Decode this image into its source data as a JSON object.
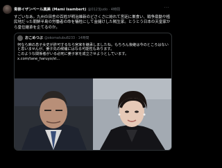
{
  "post": {
    "author_name": "青柳イザンベール真美 (Mami Isambert)",
    "author_handle": "@0123Judo · 4時間",
    "more_icon": "...",
    "body": "すごいなあ。九州の田舎の百姓が明治維新のどさくさに紛れて宮廷に巣食い、戦争扇動や植民地だった朝鮮半島の労働者の命を犠牲にして金儲けした賊生家。とうとう日本の天皇家から皇位継承を企てるのか。",
    "quote": {
      "author_name": "おこめつぶ",
      "author_handle": "@okomatubu8233 · 14時間",
      "text": "何なら麻の息子女史が許可するなら宮家を継承しましたね。もちろん後継は今のところはないと思いませんが、姜子先の候補にはなる可能性もあります。",
      "text2": "このような関係者がいる必死に姜子家を成立させようとしています。",
      "link": "x.com/tane_haruyo/st..."
    }
  }
}
